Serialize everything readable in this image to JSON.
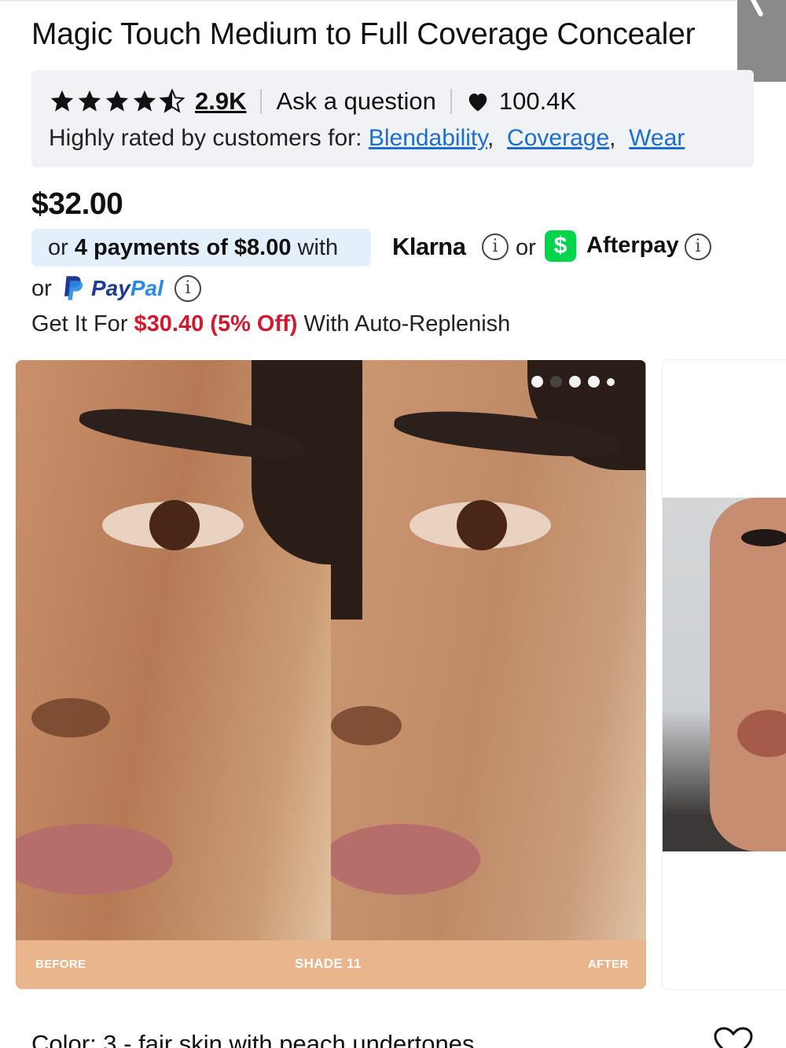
{
  "product": {
    "title": "Magic Touch Medium to Full Coverage Concealer",
    "rating_stars": 4.5,
    "review_count": "2.9K",
    "ask_question": "Ask a question",
    "loves_count": "100.4K",
    "highly_rated_prefix": "Highly rated by customers for:",
    "highly_rated_tags": [
      "Blendability",
      "Coverage",
      "Wear"
    ],
    "price": "$32.00"
  },
  "payments": {
    "or_1": "or",
    "installments_bold": "4 payments of $8.00",
    "with": "with",
    "klarna": "Klarna",
    "or_2": "or",
    "cashapp_symbol": "$",
    "afterpay": "Afterpay",
    "or_3": "or",
    "paypal_pay": "Pay",
    "paypal_pal": "Pal",
    "info_glyph": "i"
  },
  "replenish": {
    "prefix": "Get It For",
    "discount": "$30.40 (5% Off)",
    "suffix": "With Auto-Replenish"
  },
  "gallery": {
    "image_count": 5,
    "active_index": 1,
    "caption_before": "BEFORE",
    "caption_center": "SHADE 11",
    "caption_after": "AFTER"
  },
  "color_selector": {
    "text": "Color: 3 - fair skin with peach undertones"
  },
  "colors": {
    "link": "#1a6fd1",
    "discount": "#cf1a2f",
    "pill_bg": "#e4effc",
    "caption_bar": "#e8b58c",
    "cashapp": "#00d54b"
  }
}
